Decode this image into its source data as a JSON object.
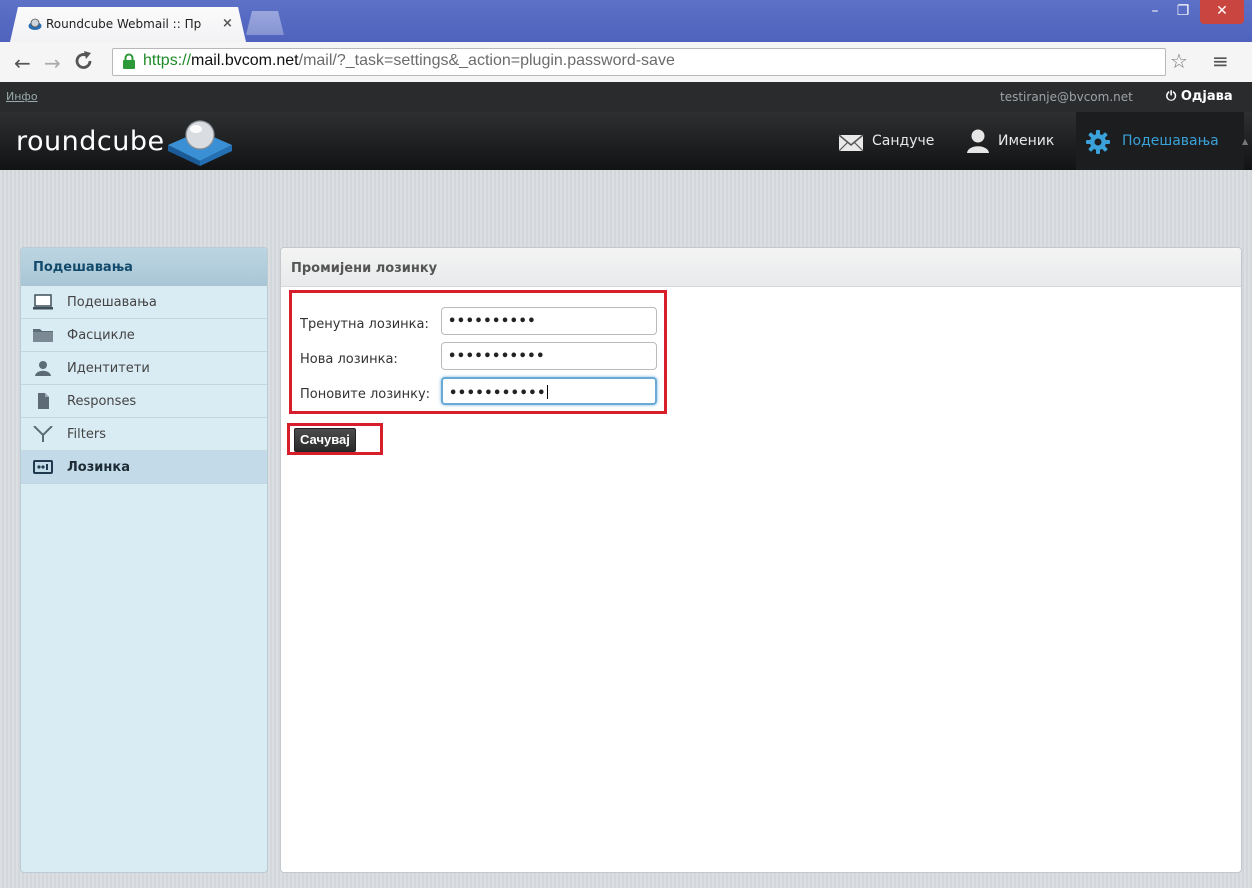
{
  "browser": {
    "tab_title": "Roundcube Webmail :: Пр",
    "tab_close": "×",
    "url_scheme": "https://",
    "url_host": "mail.bvcom.net",
    "url_path": "/mail/?_task=settings&_action=plugin.password-save",
    "win_min": "–",
    "win_max": "❐",
    "win_close": "✕"
  },
  "topbar": {
    "info_link": "Инфо",
    "username": "testiranje@bvcom.net",
    "logout_label": "Одјава"
  },
  "header": {
    "logo_text": "roundcube",
    "nav": {
      "mail": "Сандуче",
      "contacts": "Именик",
      "settings": "Подешавања"
    }
  },
  "sidebar": {
    "title": "Подешавања",
    "items": [
      {
        "label": "Подешавања",
        "icon": "monitor-icon"
      },
      {
        "label": "Фасцикле",
        "icon": "folder-icon"
      },
      {
        "label": "Идентитети",
        "icon": "person-icon"
      },
      {
        "label": "Responses",
        "icon": "document-icon"
      },
      {
        "label": "Filters",
        "icon": "filter-icon"
      },
      {
        "label": "Лозинка",
        "icon": "password-icon",
        "active": true
      }
    ]
  },
  "content": {
    "title": "Промијени лозинку",
    "fields": {
      "current_label": "Тренутна лозинка:",
      "current_value": "••••••••••",
      "new_label": "Нова лозинка:",
      "new_value": "•••••••••••",
      "confirm_label": "Поновите лозинку:",
      "confirm_value": "•••••••••••"
    },
    "save_label": "Сачувај"
  },
  "colors": {
    "accent": "#3aa1d9",
    "highlight_border": "#d61f2a",
    "titlebar": "#5566c2"
  }
}
